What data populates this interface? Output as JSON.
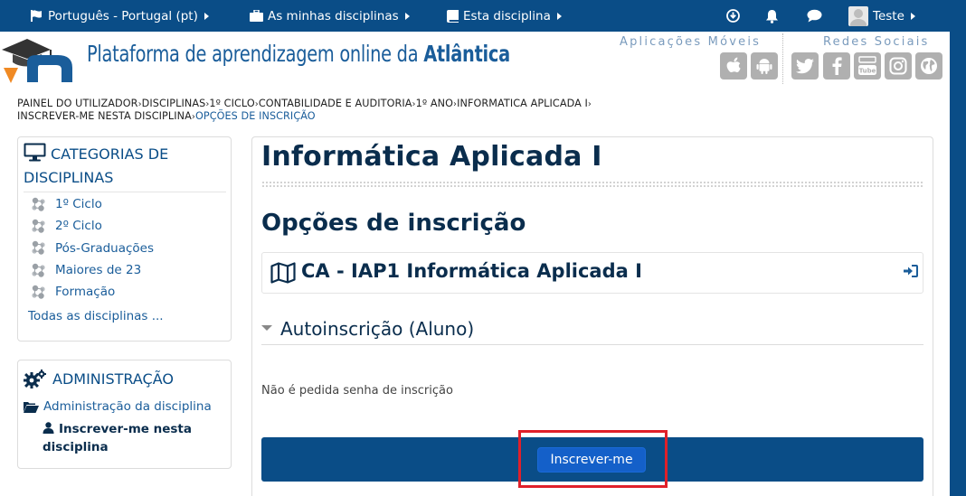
{
  "topbar": {
    "language": "Português - Portugal (pt)",
    "my_courses": "As minhas disciplinas",
    "this_course": "Esta disciplina",
    "user": "Teste"
  },
  "header": {
    "site_title_prefix": "Plataforma de aprendizagem online da ",
    "site_title_brand": "Atlântica",
    "apps_label": "Aplicações Móveis",
    "social_label": "Redes Sociais"
  },
  "breadcrumb": [
    "PAINEL DO UTILIZADOR",
    "DISCIPLINAS",
    "1º CICLO",
    "CONTABILIDADE E AUDITORIA",
    "1º ANO",
    "INFORMATICA APLICADA I",
    "INSCREVER-ME NESTA DISCIPLINA",
    "OPÇÕES DE INSCRIÇÃO"
  ],
  "categories": {
    "title": "CATEGORIAS DE DISCIPLINAS",
    "items": [
      "1º Ciclo",
      "2º Ciclo",
      "Pós-Graduações",
      "Maiores de 23",
      "Formação"
    ],
    "all_link": "Todas as disciplinas ..."
  },
  "administration": {
    "title": "ADMINISTRAÇÃO",
    "course_admin": "Administração da disciplina",
    "enrol_me": "Inscrever-me nesta disciplina"
  },
  "main": {
    "course_heading": "Informática Aplicada I",
    "options_heading": "Opções de inscrição",
    "course_name": "CA - IAP1 Informática Aplicada I",
    "self_enrol": "Autoinscrição (Aluno)",
    "no_password": "Não é pedida senha de inscrição",
    "enrol_button": "Inscrever-me"
  },
  "colors": {
    "navbar": "#0a4d87",
    "heading": "#0a2d4d",
    "link": "#1a5d9a",
    "button": "#1460c9",
    "highlight": "#e0202a"
  }
}
